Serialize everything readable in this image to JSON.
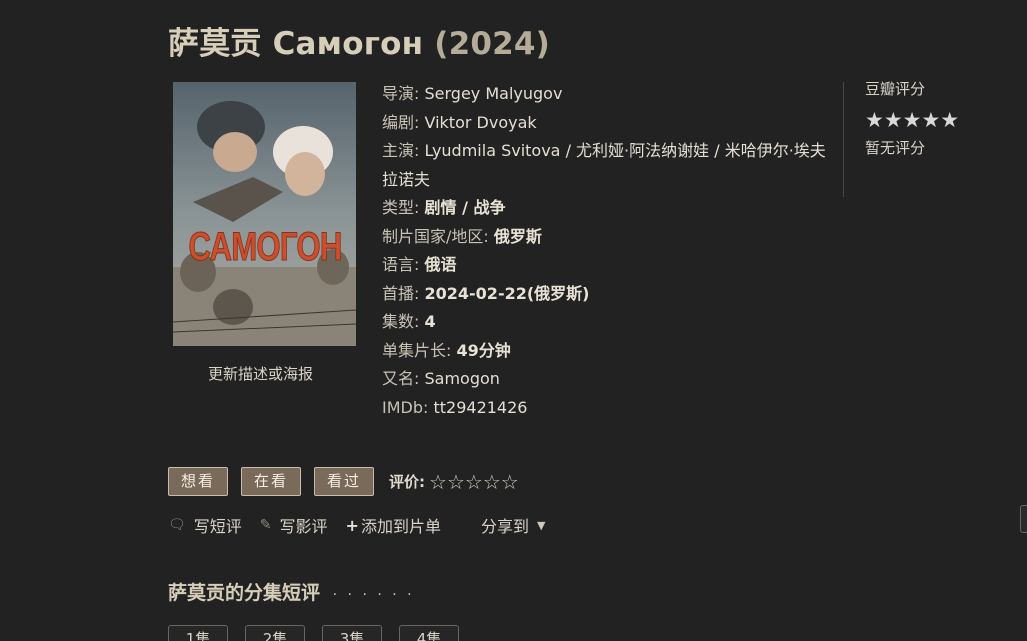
{
  "title": {
    "name": "萨莫贡 Самогон",
    "year": "(2024)"
  },
  "poster": {
    "text": "САМОГОН",
    "update_link": "更新描述或海报"
  },
  "info": {
    "director": {
      "label": "导演:",
      "value": "Sergey Malyugov"
    },
    "writer": {
      "label": "编剧:",
      "value": "Viktor Dvoyak"
    },
    "cast": {
      "label": "主演:",
      "value": "Lyudmila Svitova / 尤利娅·阿法纳谢娃 / 米哈伊尔·埃夫拉诺夫"
    },
    "genre": {
      "label": "类型:",
      "value": "剧情 / 战争"
    },
    "country": {
      "label": "制片国家/地区:",
      "value": "俄罗斯"
    },
    "language": {
      "label": "语言:",
      "value": "俄语"
    },
    "premiere": {
      "label": "首播:",
      "value": "2024-02-22(俄罗斯)"
    },
    "episodes": {
      "label": "集数:",
      "value": "4"
    },
    "runtime": {
      "label": "单集片长:",
      "value": "49分钟"
    },
    "aka": {
      "label": "又名:",
      "value": "Samogon"
    },
    "imdb": {
      "label": "IMDb:",
      "value": "tt29421426"
    }
  },
  "rating": {
    "title": "豆瓣评分",
    "stars": "★★★★★",
    "none": "暂无评分"
  },
  "actions": {
    "want": "想看",
    "watching": "在看",
    "watched": "看过",
    "rate_label": "评价:",
    "rate_stars": "☆☆☆☆☆"
  },
  "links": {
    "short_review": "写短评",
    "review": "写影评",
    "add_list": "添加到片单",
    "share": "分享到"
  },
  "episodes_section": {
    "title": "萨莫贡的分集短评",
    "dots": "· · · · · ·",
    "tabs": [
      "1集",
      "2集",
      "3集",
      "4集"
    ]
  },
  "icons": {
    "comment": "speech-bubble-icon",
    "pencil": "pencil-icon",
    "plus": "plus-icon",
    "caret": "caret-down-icon"
  }
}
